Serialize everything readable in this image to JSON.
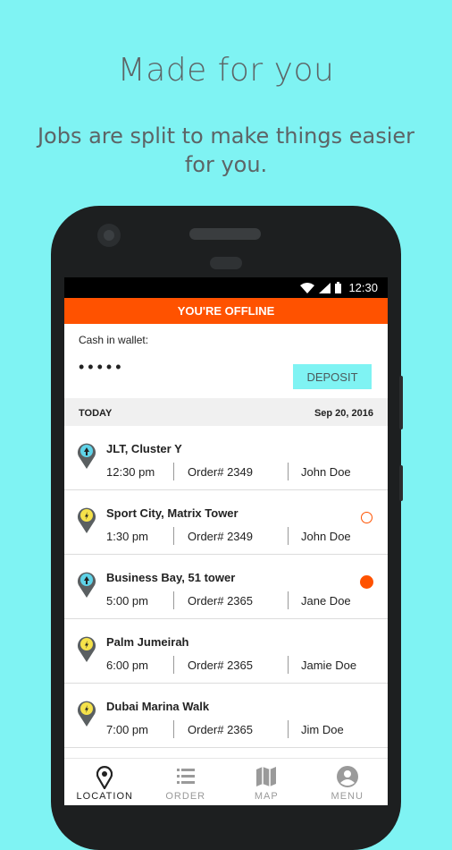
{
  "promo": {
    "title": "Made for you",
    "subtitle": "Jobs are split to make things easier for you."
  },
  "status_bar": {
    "time": "12:30"
  },
  "banner": {
    "text": "YOU'RE OFFLINE",
    "color": "#ff5200"
  },
  "wallet": {
    "label": "Cash in wallet:",
    "masked_value": "•••••",
    "deposit_label": "DEPOSIT"
  },
  "day_header": {
    "day": "TODAY",
    "date": "Sep 20, 2016"
  },
  "jobs": [
    {
      "place": "JLT, Cluster Y",
      "time": "12:30 pm",
      "order": "Order# 2349",
      "name": "John Doe",
      "pin": "pickup-pin-icon",
      "status": "none"
    },
    {
      "place": "Sport City, Matrix Tower",
      "time": "1:30 pm",
      "order": "Order# 2349",
      "name": "John Doe",
      "pin": "dropoff-pin-icon",
      "status": "open"
    },
    {
      "place": "Business Bay, 51 tower",
      "time": "5:00 pm",
      "order": "Order# 2365",
      "name": "Jane Doe",
      "pin": "pickup-pin-icon",
      "status": "filled"
    },
    {
      "place": "Palm Jumeirah",
      "time": "6:00 pm",
      "order": "Order# 2365",
      "name": "Jamie Doe",
      "pin": "dropoff-pin-icon",
      "status": "none"
    },
    {
      "place": "Dubai Marina Walk",
      "time": "7:00 pm",
      "order": "Order# 2365",
      "name": "Jim Doe",
      "pin": "dropoff-pin-icon",
      "status": "none"
    }
  ],
  "tabs": [
    {
      "label": "LOCATION",
      "icon": "location-pin-icon",
      "active": true
    },
    {
      "label": "ORDER",
      "icon": "list-icon",
      "active": false
    },
    {
      "label": "MAP",
      "icon": "map-icon",
      "active": false
    },
    {
      "label": "MENU",
      "icon": "account-icon",
      "active": false
    }
  ],
  "colors": {
    "background": "#7ff3f3",
    "accent": "#ff5200",
    "pickup_pin": "#5fd3e8",
    "dropoff_pin": "#f5e24a"
  }
}
